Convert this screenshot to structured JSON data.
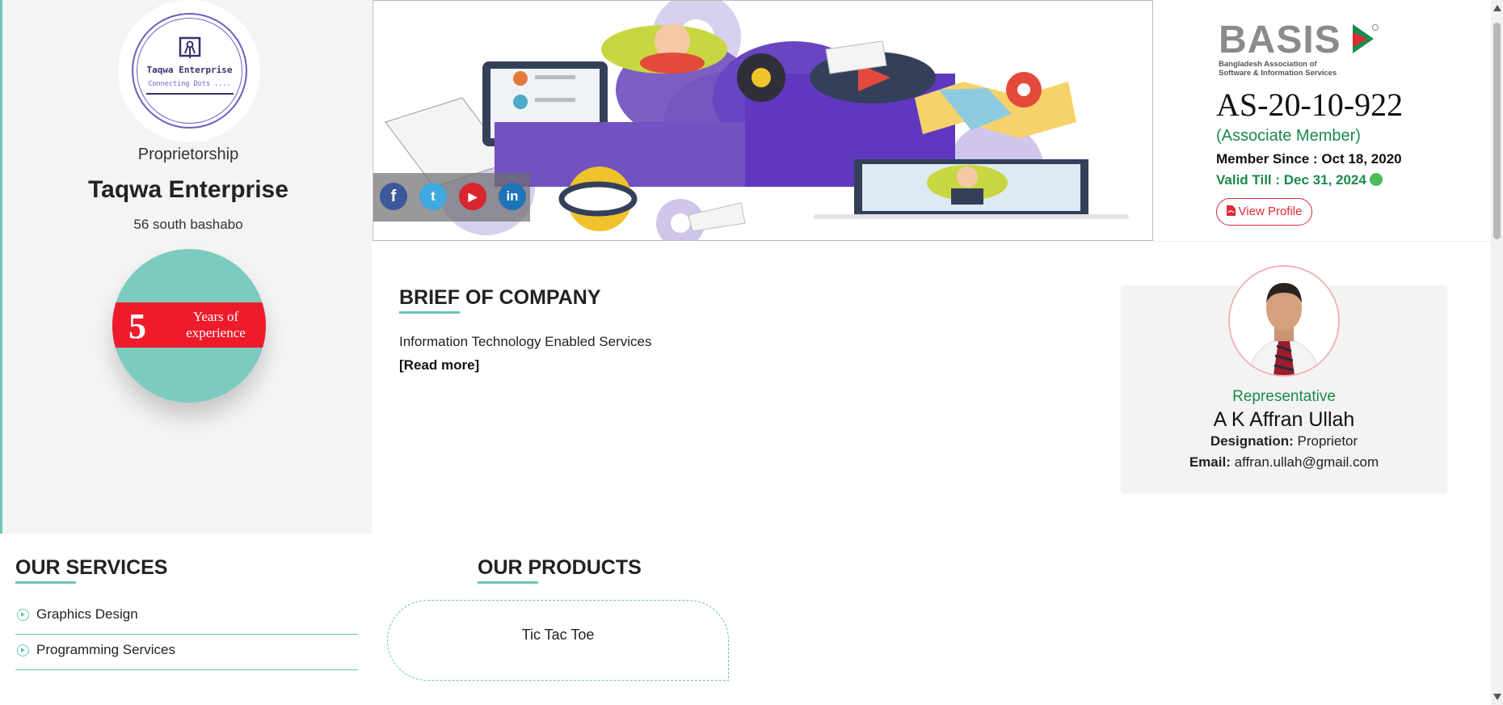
{
  "company": {
    "logo_brand": "Taqwa Enterprise",
    "logo_tagline": "Connecting Dots ....",
    "type": "Proprietorship",
    "name": "Taqwa Enterprise",
    "address": "56 south bashabo",
    "experience_years": "5",
    "experience_text": "Years of experience"
  },
  "social": {
    "facebook": "f",
    "twitter": "t",
    "youtube": "▶",
    "linkedin": "in"
  },
  "membership": {
    "logo_word": "BASIS",
    "logo_subtitle_line1": "Bangladesh Association of",
    "logo_subtitle_line2": "Software & Information Services",
    "member_id": "AS-20-10-922",
    "member_type": "(Associate Member)",
    "member_since": "Member Since : Oct 18, 2020",
    "valid_till": "Valid Till : Dec 31, 2024",
    "view_profile": "View Profile"
  },
  "brief": {
    "title": "BRIEF OF COMPANY",
    "text": "Information Technology Enabled Services",
    "read_more": "[Read more]"
  },
  "representative": {
    "label": "Representative",
    "name": "A K Affran Ullah",
    "designation_label": "Designation:",
    "designation": "Proprietor",
    "email_label": "Email:",
    "email": "affran.ullah@gmail.com"
  },
  "services": {
    "title": "OUR SERVICES",
    "items": [
      "Graphics Design",
      "Programming Services"
    ]
  },
  "products": {
    "title": "OUR PRODUCTS",
    "items": [
      "Tic Tac Toe"
    ]
  },
  "colors": {
    "accent": "#6bc5b8",
    "red": "#ee1c2b",
    "green": "#1a8a4b",
    "purple": "#6f5fc3"
  },
  "icons": {
    "service_bullet": "circle-chevron-right-icon",
    "pdf": "pdf-icon",
    "status": "active-status-dot"
  }
}
